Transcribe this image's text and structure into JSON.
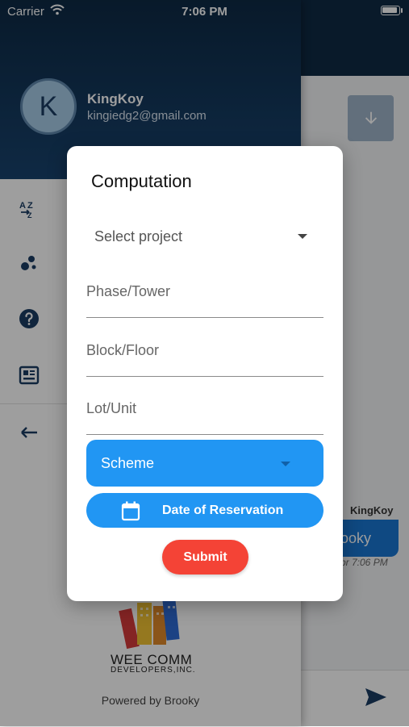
{
  "status_bar": {
    "carrier": "Carrier",
    "time": "7:06 PM"
  },
  "drawer": {
    "avatar_initial": "K",
    "user_name": "KingKoy",
    "user_email": "kingiedg2@gmail.com",
    "menu_icons": [
      "sort-az-icon",
      "bubbles-icon",
      "help-icon",
      "news-icon",
      "back-arrow-icon"
    ],
    "company_name": "WEE COMM",
    "company_sub": "DEVELOPERS,INC.",
    "powered_by": "Powered by Brooky"
  },
  "background_chat": {
    "sender": "KingKoy",
    "message_fragment": "ooky",
    "timestamp_fragment": "pr 7:06 PM"
  },
  "dialog": {
    "title": "Computation",
    "project_select": {
      "selected": "Select project"
    },
    "fields": {
      "phase_placeholder": "Phase/Tower",
      "block_placeholder": "Block/Floor",
      "lot_placeholder": "Lot/Unit"
    },
    "scheme_label": "Scheme",
    "date_button_label": "Date of Reservation",
    "submit_label": "Submit"
  },
  "colors": {
    "primary_blue": "#2196f3",
    "submit_red": "#f44336",
    "header_navy": "#0e2a45"
  }
}
